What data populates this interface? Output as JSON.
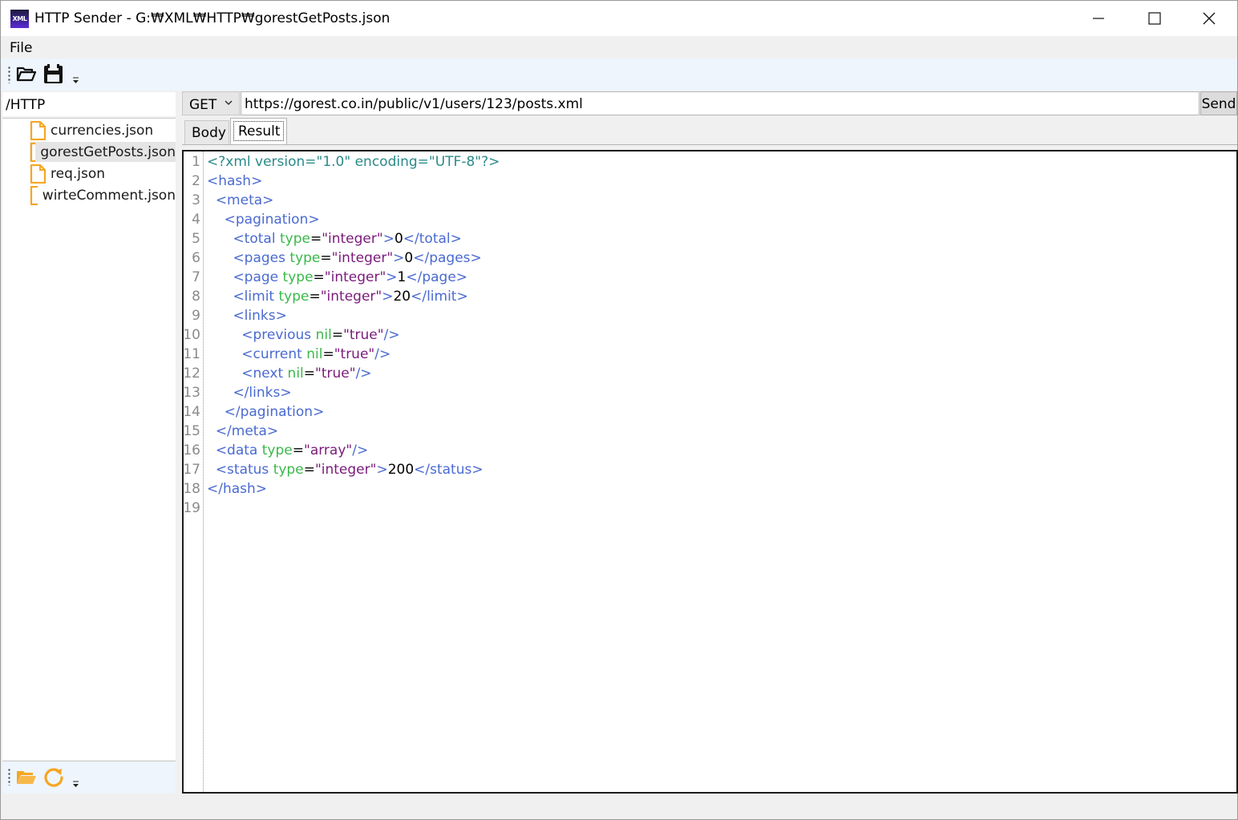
{
  "window": {
    "title": "HTTP Sender - G:₩XML₩HTTP₩gorestGetPosts.json",
    "app_icon_text": "XML"
  },
  "menu": {
    "file_label": "File"
  },
  "toolbar": {
    "icons": [
      "open-folder-icon",
      "save-icon",
      "overflow-arrow-icon"
    ]
  },
  "explorer": {
    "path": "/HTTP",
    "files": [
      {
        "label": "currencies.json",
        "selected": false
      },
      {
        "label": "gorestGetPosts.json",
        "selected": true
      },
      {
        "label": "req.json",
        "selected": false
      },
      {
        "label": "wirteComment.json",
        "selected": false
      }
    ],
    "bottom_icons": [
      "folder-icon",
      "refresh-icon",
      "overflow-arrow-icon"
    ]
  },
  "request": {
    "method": "GET",
    "url": "https://gorest.co.in/public/v1/users/123/posts.xml",
    "send_label": "Send"
  },
  "tabs": [
    {
      "label": "Body",
      "active": false
    },
    {
      "label": "Result",
      "active": true
    }
  ],
  "editor": {
    "line_numbers": [
      "1",
      "2",
      "3",
      "4",
      "5",
      "6",
      "7",
      "8",
      "9",
      "10",
      "11",
      "12",
      "13",
      "14",
      "15",
      "16",
      "17",
      "18",
      "19"
    ],
    "lines": [
      [
        [
          "decl",
          "<?xml version=\"1.0\" encoding=\"UTF-8\"?>"
        ]
      ],
      [
        [
          "tag",
          "<hash>"
        ]
      ],
      [
        [
          "text",
          "  "
        ],
        [
          "tag",
          "<meta>"
        ]
      ],
      [
        [
          "text",
          "    "
        ],
        [
          "tag",
          "<pagination>"
        ]
      ],
      [
        [
          "text",
          "      "
        ],
        [
          "tag",
          "<total "
        ],
        [
          "attr",
          "type"
        ],
        [
          "text",
          "="
        ],
        [
          "val",
          "\"integer\""
        ],
        [
          "tag",
          ">"
        ],
        [
          "text",
          "0"
        ],
        [
          "tag",
          "</total>"
        ]
      ],
      [
        [
          "text",
          "      "
        ],
        [
          "tag",
          "<pages "
        ],
        [
          "attr",
          "type"
        ],
        [
          "text",
          "="
        ],
        [
          "val",
          "\"integer\""
        ],
        [
          "tag",
          ">"
        ],
        [
          "text",
          "0"
        ],
        [
          "tag",
          "</pages>"
        ]
      ],
      [
        [
          "text",
          "      "
        ],
        [
          "tag",
          "<page "
        ],
        [
          "attr",
          "type"
        ],
        [
          "text",
          "="
        ],
        [
          "val",
          "\"integer\""
        ],
        [
          "tag",
          ">"
        ],
        [
          "text",
          "1"
        ],
        [
          "tag",
          "</page>"
        ]
      ],
      [
        [
          "text",
          "      "
        ],
        [
          "tag",
          "<limit "
        ],
        [
          "attr",
          "type"
        ],
        [
          "text",
          "="
        ],
        [
          "val",
          "\"integer\""
        ],
        [
          "tag",
          ">"
        ],
        [
          "text",
          "20"
        ],
        [
          "tag",
          "</limit>"
        ]
      ],
      [
        [
          "text",
          "      "
        ],
        [
          "tag",
          "<links>"
        ]
      ],
      [
        [
          "text",
          "        "
        ],
        [
          "tag",
          "<previous "
        ],
        [
          "attr",
          "nil"
        ],
        [
          "text",
          "="
        ],
        [
          "val",
          "\"true\""
        ],
        [
          "tag",
          "/>"
        ]
      ],
      [
        [
          "text",
          "        "
        ],
        [
          "tag",
          "<current "
        ],
        [
          "attr",
          "nil"
        ],
        [
          "text",
          "="
        ],
        [
          "val",
          "\"true\""
        ],
        [
          "tag",
          "/>"
        ]
      ],
      [
        [
          "text",
          "        "
        ],
        [
          "tag",
          "<next "
        ],
        [
          "attr",
          "nil"
        ],
        [
          "text",
          "="
        ],
        [
          "val",
          "\"true\""
        ],
        [
          "tag",
          "/>"
        ]
      ],
      [
        [
          "text",
          "      "
        ],
        [
          "tag",
          "</links>"
        ]
      ],
      [
        [
          "text",
          "    "
        ],
        [
          "tag",
          "</pagination>"
        ]
      ],
      [
        [
          "text",
          "  "
        ],
        [
          "tag",
          "</meta>"
        ]
      ],
      [
        [
          "text",
          "  "
        ],
        [
          "tag",
          "<data "
        ],
        [
          "attr",
          "type"
        ],
        [
          "text",
          "="
        ],
        [
          "val",
          "\"array\""
        ],
        [
          "tag",
          "/>"
        ]
      ],
      [
        [
          "text",
          "  "
        ],
        [
          "tag",
          "<status "
        ],
        [
          "attr",
          "type"
        ],
        [
          "text",
          "="
        ],
        [
          "val",
          "\"integer\""
        ],
        [
          "tag",
          ">"
        ],
        [
          "text",
          "200"
        ],
        [
          "tag",
          "</status>"
        ]
      ],
      [
        [
          "tag",
          "</hash>"
        ]
      ],
      []
    ]
  },
  "colors": {
    "xml_declaration": "#2a8a8a",
    "xml_tag": "#4a6ad0",
    "xml_attribute": "#3ab84a",
    "xml_value": "#7a1a7a",
    "toolbar_bg": "#eef5fc",
    "file_icon": "#f5a623"
  }
}
